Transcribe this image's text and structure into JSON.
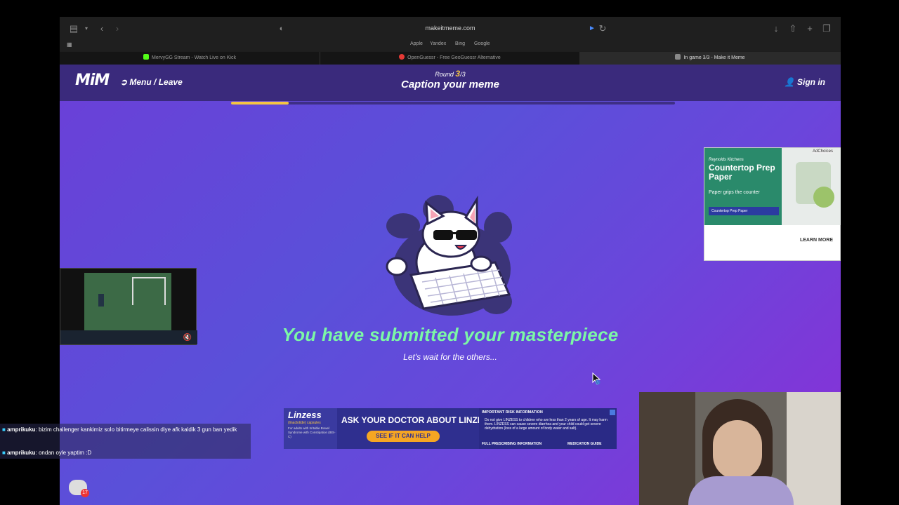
{
  "browser": {
    "url": "makeitmeme.com",
    "favorites": [
      "Apple",
      "Yandex",
      "Bing",
      "Google"
    ],
    "tabs": [
      {
        "label": "MervyGG Stream - Watch Live on Kick",
        "color": "#53fc18",
        "active": false
      },
      {
        "label": "OpenGuessr - Free GeoGuessr Alternative",
        "color": "#e53935",
        "active": false
      },
      {
        "label": "In game 3/3 - Make it Meme",
        "color": "#888888",
        "active": true
      }
    ]
  },
  "header": {
    "logo": "MiM",
    "menu_label": "Menu / Leave",
    "round_prefix": "Round",
    "round_current": "3",
    "round_total": "/3",
    "title": "Caption your meme",
    "signin_label": "Sign in"
  },
  "progress": {
    "fraction": 0.13
  },
  "main": {
    "message": "You have submitted your masterpiece",
    "submessage": "Let's wait for the others..."
  },
  "ad_right": {
    "brand": "Reynolds Kitchens",
    "headline": "Countertop Prep Paper",
    "sub": "Paper grips the counter",
    "product": "Countertop Prep Paper",
    "cta": "LEARN MORE",
    "adchoices": "AdChoices"
  },
  "ad_linzess": {
    "brand": "Linzess",
    "brand_sub": "(linaclotide) capsules",
    "brand_note": "For adults with Irritable Bowel Syndrome with Constipation (IBS-C)",
    "headline": "ASK YOUR DOCTOR ABOUT LINZESS",
    "cta": "SEE IF IT CAN HELP",
    "risk_title": "IMPORTANT RISK INFORMATION",
    "risk_text": "Do not give LINZESS to children who are less than 2 years of age. It may harm them. LINZESS can cause severe diarrhea and your child could get severe dehydration (loss of a large amount of body water and salt).",
    "link_prescribing": "FULL PRESCRIBING INFORMATION",
    "link_guide": "MEDICATION GUIDE"
  },
  "chat": {
    "lines": [
      {
        "user": "amprikuku",
        "text": ": bizim challenger kankimiz solo bitirmeye calissin diye afk kaldik 3 gun ban yedik"
      },
      {
        "user": "amprikuku",
        "text": ": ondan oyle yaptim :D"
      }
    ],
    "badge": "17"
  },
  "colors": {
    "accent": "#f5c542",
    "success": "#7cf7a6",
    "header_bg": "#3a2a7c"
  }
}
